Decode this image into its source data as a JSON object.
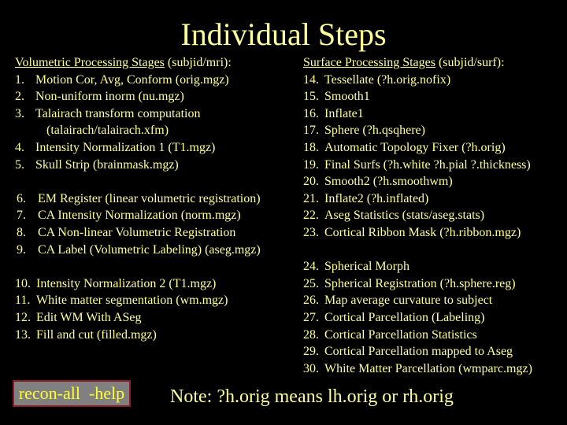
{
  "title": "Individual Steps",
  "volumetric": {
    "heading_underlined": "Volumetric Processing Stages",
    "heading_suffix": " (subjid/mri):",
    "group1": [
      {
        "num": "1.",
        "text": "Motion Cor, Avg, Conform (orig.mgz)"
      },
      {
        "num": "2.",
        "text": "Non-uniform inorm (nu.mgz)"
      },
      {
        "num": "3.",
        "text": "Talairach transform computation"
      },
      {
        "num": "",
        "text": "(talairach/talairach.xfm)"
      },
      {
        "num": "4.",
        "text": "Intensity Normalization 1 (T1.mgz)"
      },
      {
        "num": "5.",
        "text": "Skull Strip (brainmask.mgz)"
      }
    ],
    "group2": [
      {
        "num": "6.",
        "text": "EM Register (linear volumetric registration)"
      },
      {
        "num": "7.",
        "text": "CA Intensity Normalization (norm.mgz)"
      },
      {
        "num": "8.",
        "text": "CA Non-linear Volumetric Registration"
      },
      {
        "num": "9.",
        "text": "CA Label (Volumetric Labeling) (aseg.mgz)"
      }
    ],
    "group3": [
      {
        "num": "10.",
        "text": "Intensity Normalization 2 (T1.mgz)"
      },
      {
        "num": "11.",
        "text": "White matter segmentation (wm.mgz)"
      },
      {
        "num": "12.",
        "text": "Edit WM With ASeg"
      },
      {
        "num": "13.",
        "text": "Fill and cut (filled.mgz)"
      }
    ]
  },
  "surface": {
    "heading_underlined": "Surface Processing Stages",
    "heading_suffix": " (subjid/surf):",
    "group1": [
      {
        "num": "14.",
        "text": "Tessellate (?h.orig.nofix)"
      },
      {
        "num": "15.",
        "text": "Smooth1"
      },
      {
        "num": "16.",
        "text": "Inflate1"
      },
      {
        "num": "17.",
        "text": "Sphere (?h.qsqhere)"
      },
      {
        "num": "18.",
        "text": "Automatic Topology Fixer (?h.orig)"
      },
      {
        "num": "19.",
        "text": "Final Surfs (?h.white ?h.pial ?.thickness)"
      },
      {
        "num": "20.",
        "text": "Smooth2 (?h.smoothwm)"
      },
      {
        "num": "21.",
        "text": "Inflate2 (?h.inflated)"
      },
      {
        "num": "22.",
        "text": "Aseg Statistics (stats/aseg.stats)"
      },
      {
        "num": "23.",
        "text": "Cortical Ribbon Mask (?h.ribbon.mgz)"
      }
    ],
    "group2": [
      {
        "num": "24.",
        "text": "Spherical Morph"
      },
      {
        "num": "25.",
        "text": "Spherical Registration (?h.sphere.reg)"
      },
      {
        "num": "26.",
        "text": "Map average curvature to subject"
      },
      {
        "num": "27.",
        "text": "Cortical Parcellation (Labeling)"
      },
      {
        "num": "28.",
        "text": "Cortical Parcellation Statistics"
      },
      {
        "num": "29.",
        "text": "Cortical Parcellation mapped to Aseg"
      },
      {
        "num": "30.",
        "text": "White Matter Parcellation (wmparc.mgz)"
      }
    ]
  },
  "help_button": {
    "label": "recon-all  -help"
  },
  "note": "Note: ?h.orig means lh.orig or rh.orig",
  "colors": {
    "background": "#000000",
    "text": "#ffff99",
    "button_bg": "#808080",
    "button_border": "#8b1a2a",
    "button_text": "#ffff33"
  }
}
